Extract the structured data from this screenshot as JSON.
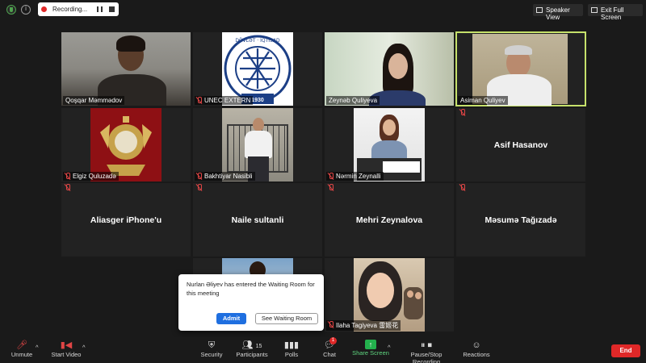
{
  "topbar": {
    "recording_label": "Recording...",
    "speaker_view_label": "Speaker View",
    "exit_full_screen_label": "Exit Full Screen"
  },
  "participants_tiles": [
    {
      "name": "Qoşqar Məmmədov",
      "muted": false,
      "video": true
    },
    {
      "name": "UNEC EXTERN",
      "muted": true,
      "video": true
    },
    {
      "name": "Zeynəb Quliyeva",
      "muted": false,
      "video": true
    },
    {
      "name": "Asiman Quliyev",
      "muted": false,
      "video": true,
      "active": true
    },
    {
      "name": "Elgiz Quluzadə",
      "muted": true,
      "video": true
    },
    {
      "name": "Bakhtiyar Nasibli",
      "muted": true,
      "video": true
    },
    {
      "name": "Nərmin Zeynalli",
      "muted": true,
      "video": true
    },
    {
      "name": "Asif Hasanov",
      "muted": true,
      "video": false
    },
    {
      "name": "Aliasger iPhone'u",
      "muted": true,
      "video": false
    },
    {
      "name": "Naile sultanli",
      "muted": true,
      "video": false
    },
    {
      "name": "Mehri Zeynalova",
      "muted": true,
      "video": false
    },
    {
      "name": "Məsumə Tağızadə",
      "muted": true,
      "video": false
    },
    {
      "name": "Ilaha Tagiyeva 雷姬花",
      "muted": true,
      "video": true
    }
  ],
  "unec_logo_year": "1930",
  "popup": {
    "message": "Nurlan Əliyev has entered the Waiting Room for this meeting",
    "admit_label": "Admit",
    "see_waiting_room_label": "See Waiting Room"
  },
  "toolbar": {
    "unmute_label": "Unmute",
    "start_video_label": "Start Video",
    "security_label": "Security",
    "participants_label": "Participants",
    "participants_count": "15",
    "polls_label": "Polls",
    "chat_label": "Chat",
    "chat_badge": "1",
    "share_screen_label": "Share Screen",
    "pause_stop_recording_label": "Pause/Stop Recording",
    "reactions_label": "Reactions",
    "end_label": "End"
  },
  "colors": {
    "active_speaker_border": "#c6e16b",
    "end_button": "#e02828",
    "share_screen": "#23b14d",
    "admit_button": "#1f6fe0"
  }
}
